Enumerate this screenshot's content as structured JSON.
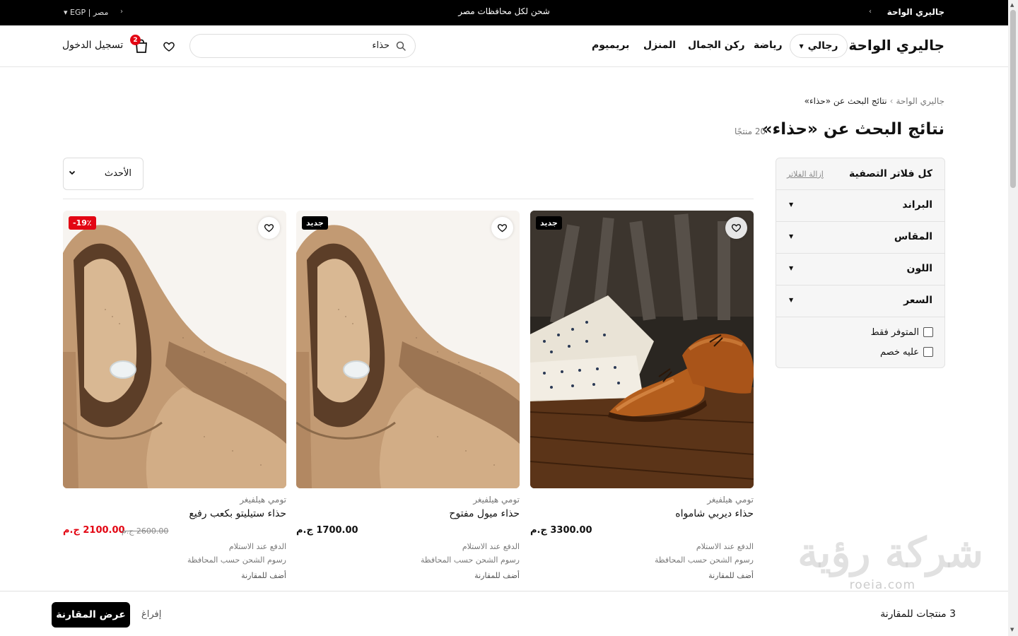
{
  "topbar": {
    "brand": "جاليري الواحة",
    "promo": "شحن لكل محافظات مصر",
    "country": "مصر",
    "currency": "EGP",
    "locale_separator": "|"
  },
  "header": {
    "logo": "جاليري الواحة",
    "nav": [
      "رجالي",
      "رياضة",
      "ركن الجمال",
      "المنزل",
      "بريميوم"
    ],
    "search": {
      "value": "حذاء",
      "placeholder": ""
    },
    "cart_count": "2",
    "login_label": "تسجيل الدخول"
  },
  "breadcrumb": {
    "home": "جاليري الواحة",
    "separator": "›",
    "current": "نتائج البحث عن «حذاء»"
  },
  "page": {
    "title": "نتائج البحث عن «حذاء»",
    "result_count": "20 منتجًا"
  },
  "filters": {
    "title": "كل فلاتر التصفية",
    "clear_label": "إزالة الفلاتر",
    "groups": [
      "البراند",
      "المقاس",
      "اللون",
      "السعر"
    ],
    "checks": [
      "المتوفر فقط",
      "عليه خصم"
    ]
  },
  "sort": {
    "label": "الأحدث"
  },
  "products": [
    {
      "badge": "جديد",
      "brand": "تومي هيلفيغر",
      "name": "حذاء ديربي شامواه",
      "price": "3300.00 ج.م",
      "old_price": "",
      "notes": [
        "الدفع عند الاستلام",
        "رسوم الشحن حسب المحافظة"
      ],
      "compare_label": "أضف للمقارنة"
    },
    {
      "badge": "جديد",
      "brand": "تومي هيلفيغر",
      "name": "حذاء ميول مفتوح",
      "price": "1700.00 ج.م",
      "old_price": "",
      "notes": [
        "الدفع عند الاستلام",
        "رسوم الشحن حسب المحافظة"
      ],
      "compare_label": "أضف للمقارنة"
    },
    {
      "badge": "-19٪",
      "brand": "تومي هيلفيغر",
      "name": "حذاء ستيليتو بكعب رفيع",
      "price": "2100.00 ج.م",
      "old_price": "2600.00 ج.م",
      "notes": [
        "الدفع عند الاستلام",
        "رسوم الشحن حسب المحافظة"
      ],
      "compare_label": "أضف للمقارنة"
    }
  ],
  "compare_bar": {
    "count_label": "3 منتجات للمقارنة",
    "show_label": "عرض المقارنة",
    "clear_label": "إفراغ"
  },
  "watermark": {
    "logo_text": "شركة رؤية",
    "domain": "roeia.com"
  },
  "colors": {
    "accent": "#e30613",
    "topbar": "#000000",
    "primary_button": "#000000"
  }
}
